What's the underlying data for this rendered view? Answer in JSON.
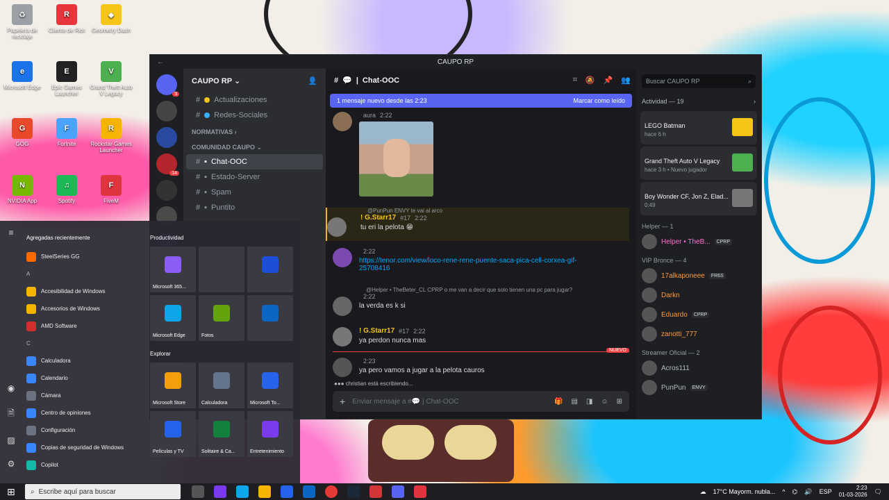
{
  "desktop": {
    "icons": [
      {
        "label": "Papelera de reciclaje",
        "color": "#9aa0a6",
        "glyph": "♻"
      },
      {
        "label": "Cliente de Riot",
        "color": "#e8343b",
        "glyph": "R"
      },
      {
        "label": "Geometry Dash",
        "color": "#f5c518",
        "glyph": "◆"
      },
      {
        "label": "Microsoft Edge",
        "color": "#1a73e8",
        "glyph": "e"
      },
      {
        "label": "Epic Games Launcher",
        "color": "#222222",
        "glyph": "E"
      },
      {
        "label": "Grand Theft Auto V Legacy",
        "color": "#4caf50",
        "glyph": "V"
      },
      {
        "label": "GOG",
        "color": "#e8492b",
        "glyph": "G"
      },
      {
        "label": "Fortnite",
        "color": "#4aa3ff",
        "glyph": "F"
      },
      {
        "label": "Rockstar Games Launcher",
        "color": "#f5b400",
        "glyph": "R"
      },
      {
        "label": "NVIDIA App",
        "color": "#76b900",
        "glyph": "N"
      },
      {
        "label": "Spotify",
        "color": "#1db954",
        "glyph": "♫"
      },
      {
        "label": "FiveM",
        "color": "#e0353f",
        "glyph": "F"
      }
    ]
  },
  "discord": {
    "window_title": "CAUPO RP",
    "server_name": "CAUPO RP",
    "server_badges": [
      "3",
      "",
      "",
      "14",
      "",
      "",
      ""
    ],
    "channels_top": [
      {
        "label": "Actualizaciones",
        "emoji": "#f5c518"
      },
      {
        "label": "Redes-Sociales",
        "emoji": "#3ab0ff"
      }
    ],
    "category_normativas": "NORMATIVAS",
    "category_comunidad": "COMUNIDAD CAUPO",
    "channels": [
      {
        "label": "Chat-OOC",
        "active": true
      },
      {
        "label": "Estado-Server",
        "active": false
      },
      {
        "label": "Spam",
        "active": false
      },
      {
        "label": "Puntito",
        "active": false
      }
    ],
    "channel_title": "Chat-OOC",
    "new_message_banner": "1 mensaje nuevo desde las 2:23",
    "mark_read": "Marcar como leído",
    "messages": [
      {
        "name": "",
        "tag": "aura",
        "time": "2:22",
        "text": "",
        "color": "#f23f43"
      },
      {
        "reply": "@PunPun ENVY te vai al arco",
        "name": "! G.Starr17",
        "tag": "#17",
        "time": "2:22",
        "text": "tu eri la pelota 😁",
        "color": "#f5c518"
      },
      {
        "name": "",
        "time": "2:22",
        "link": "https://tenor.com/view/loco-rene-rene-puente-saca-pica-cell-corxea-gif-25708416",
        "color": "#f23f43"
      },
      {
        "reply": "@Helper • TheBeter_CL CPRP o me van a decir que solo tienen una pc para jugar?",
        "name": "",
        "time": "2:22",
        "text": "la verda es k si",
        "color": "#f23f43"
      },
      {
        "name": "! G.Starr17",
        "tag": "#17",
        "time": "2:22",
        "text": "ya perdon nunca mas",
        "color": "#f5c518"
      },
      {
        "name": "",
        "time": "2:23",
        "text": "ya pero vamos a jugar a la pelota cauros",
        "color": "#f23f43"
      }
    ],
    "new_label": "NUEVO",
    "typing": "christian está escribiendo...",
    "composer_placeholder": "Enviar mensaje a #💬 | Chat-OOC",
    "search_placeholder": "Buscar CAUPO RP",
    "activity_title": "Actividad — 19",
    "activities": [
      {
        "title": "LEGO Batman",
        "sub": "hace 6 h",
        "color": "#f5c518"
      },
      {
        "title": "Grand Theft Auto V Legacy",
        "sub": "hace 3 h • Nuevo jugador",
        "color": "#4caf50"
      },
      {
        "title": "Boy Wonder CF, Jon Z, Elad...",
        "sub": "0:49",
        "color": "#777777"
      }
    ],
    "roles": [
      {
        "title": "Helper — 1",
        "members": [
          {
            "name": "Helper • TheB...",
            "color": "#ff6fd1",
            "badge": "CPRP"
          }
        ]
      },
      {
        "title": "VIP Bronce — 4",
        "members": [
          {
            "name": "17alkaponeee",
            "color": "#ff9a3c",
            "badge": "FR6S"
          },
          {
            "name": "Darkn",
            "color": "#ff9a3c",
            "badge": ""
          },
          {
            "name": "Eduardo",
            "color": "#ff9a3c",
            "badge": "CPRP"
          },
          {
            "name": "zanotti_777",
            "color": "#ff9a3c",
            "badge": ""
          }
        ]
      },
      {
        "title": "Streamer Oficial — 2",
        "members": [
          {
            "name": "Acros111",
            "color": "#b5bac1",
            "badge": ""
          },
          {
            "name": "PunPun",
            "color": "#b5bac1",
            "badge": "ENVY"
          }
        ]
      }
    ]
  },
  "start_menu": {
    "recent_header": "Agregadas recientemente",
    "apps": [
      {
        "label": "SteelSeries GG",
        "color": "#ff6a00"
      },
      {
        "label": "A",
        "letter": true
      },
      {
        "label": "Accesibilidad de Windows",
        "color": "#f5b400"
      },
      {
        "label": "Accesorios de Windows",
        "color": "#f5b400"
      },
      {
        "label": "AMD Software",
        "color": "#d32f2f"
      },
      {
        "label": "C",
        "letter": true
      },
      {
        "label": "Calculadora",
        "color": "#3a86ff"
      },
      {
        "label": "Calendario",
        "color": "#3a86ff"
      },
      {
        "label": "Cámara",
        "color": "#6b7280"
      },
      {
        "label": "Centro de opiniones",
        "color": "#3a86ff"
      },
      {
        "label": "Configuración",
        "color": "#6b7280"
      },
      {
        "label": "Copias de seguridad de Windows",
        "color": "#3a86ff"
      },
      {
        "label": "Copilot",
        "color": "#14b8a6"
      }
    ],
    "productivity_label": "Productividad",
    "tiles1": [
      {
        "label": "Microsoft 365...",
        "color": "#8b5cf6"
      },
      {
        "label": "",
        "color": "#3a3b42"
      },
      {
        "label": "",
        "color": "#1d4ed8"
      },
      {
        "label": "Microsoft Edge",
        "color": "#0ea5e9"
      },
      {
        "label": "Fotos",
        "color": "#65a30d"
      },
      {
        "label": "",
        "color": "#0a66c2"
      }
    ],
    "explore_label": "Explorar",
    "tiles2": [
      {
        "label": "Microsoft Store",
        "color": "#f59e0b"
      },
      {
        "label": "Calculadora",
        "color": "#64748b"
      },
      {
        "label": "Microsoft To...",
        "color": "#2563eb"
      },
      {
        "label": "Películas y TV",
        "color": "#2563eb"
      },
      {
        "label": "Solitaire & Ca...",
        "color": "#15803d"
      },
      {
        "label": "Entretenimiento",
        "color": "#7c3aed"
      }
    ]
  },
  "taskbar": {
    "search_placeholder": "Escribe aquí para buscar",
    "weather": "17°C Mayorm. nubla...",
    "lang": "ESP",
    "time": "2:23",
    "date": "01-03-2026"
  }
}
